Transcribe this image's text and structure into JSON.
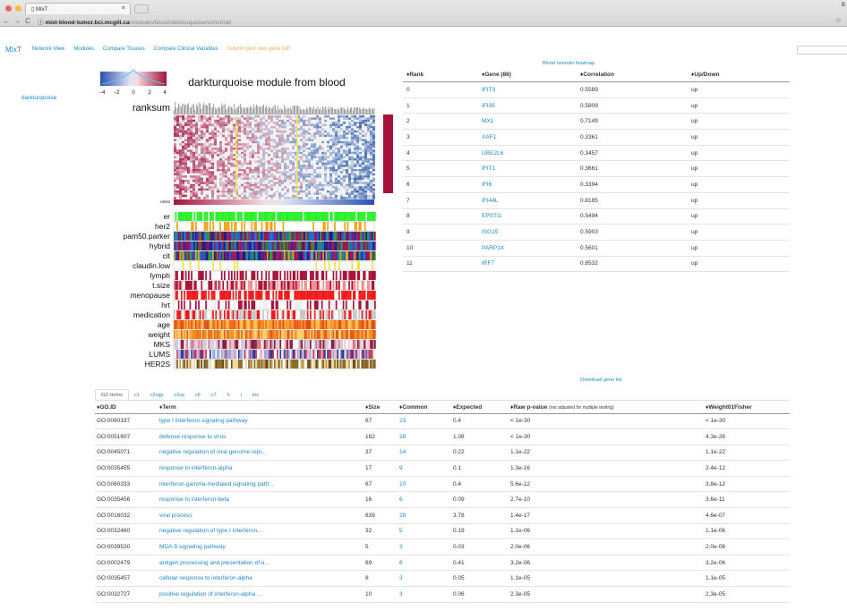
{
  "browser": {
    "tab_title": "MIxT",
    "tab_close": "×",
    "corner_label": "B",
    "url_host": "mixt-blood-tumor.bci.mcgill.ca",
    "url_path": "/modules/blood/darkturquoise/cohort/all",
    "back": "←",
    "forward": "→",
    "reload": "C",
    "info": "ⓘ",
    "star": "☆",
    "dots": [
      "#fc605c",
      "#fdbc40",
      "#34c84a"
    ]
  },
  "nav": {
    "brand": "MIxT",
    "links": [
      "Network View",
      "Modules",
      "Compare Tissues",
      "Compare Clinical Variables"
    ],
    "submit": "Submit your own gene list!",
    "search_text": "C"
  },
  "sidebar": {
    "module_link": "darkturquoise"
  },
  "figure": {
    "title": "darkturquoise module from blood",
    "ranksum_label": "ranksum",
    "ranks_label": "ranks",
    "scale_ticks": [
      "−4",
      "−2",
      "0",
      "2",
      "4"
    ],
    "track_labels": [
      "er",
      "her2",
      "pam50.parker",
      "hybrid",
      "cit",
      "claudin.low",
      "lymph",
      "t.size",
      "menopause",
      "hrt",
      "medication",
      "age",
      "weight",
      "MKS",
      "LUMS",
      "HER2S"
    ],
    "colors": {
      "red": "#a6123b",
      "blue": "#2b5aa8",
      "green": "#2bf12b",
      "orange": "#f0a21a",
      "bright_red": "#f21a1a",
      "yellow": "#f1e24a"
    }
  },
  "gene_table": {
    "heatmap_link": "Blood normals heatmap",
    "headers": [
      "♦Rank",
      "♦Gene (86)",
      "♦Correlation",
      "♦Up/Down"
    ],
    "rows": [
      [
        "0",
        "IFIT3",
        "0.5589",
        "up"
      ],
      [
        "1",
        "IFI35",
        "0.5809",
        "up"
      ],
      [
        "2",
        "MX1",
        "0.7149",
        "up"
      ],
      [
        "3",
        "XAF1",
        "0.3361",
        "up"
      ],
      [
        "4",
        "UBE2L6",
        "0.3457",
        "up"
      ],
      [
        "5",
        "IFIT1",
        "0.3661",
        "up"
      ],
      [
        "6",
        "IFI6",
        "0.3394",
        "up"
      ],
      [
        "7",
        "IFI44L",
        "0.8185",
        "up"
      ],
      [
        "8",
        "EPSTI1",
        "0.5494",
        "up"
      ],
      [
        "9",
        "ISG15",
        "0.5903",
        "up"
      ],
      [
        "10",
        "PARP14",
        "0.5601",
        "up"
      ],
      [
        "11",
        "IRF7",
        "0.8532",
        "up"
      ]
    ]
  },
  "download_label": "Download gene list",
  "go_tabs": [
    "GO terms",
    "c1",
    "c2cgp",
    "c2cp",
    "c6",
    "c7",
    "h",
    "i",
    "iris"
  ],
  "go_table": {
    "headers": [
      "♦GO.ID",
      "♦Term",
      "♦Size",
      "♦Common",
      "♦Expected",
      "♦Raw p-value",
      "♦Weight01Fisher"
    ],
    "pvalue_note": "(not adjusted for multiple testing)",
    "rows": [
      [
        "GO:0060337",
        "type I interferon signaling pathway",
        "67",
        "23",
        "0.4",
        "< 1e-30",
        "< 1e-30"
      ],
      [
        "GO:0051607",
        "defense response to virus",
        "182",
        "28",
        "1.08",
        "< 1e-30",
        "4.3e-26"
      ],
      [
        "GO:0045071",
        "negative regulation of viral genome repl...",
        "37",
        "14",
        "0.22",
        "1.1e-22",
        "1.1e-22"
      ],
      [
        "GO:0035455",
        "response to interferon-alpha",
        "17",
        "9",
        "0.1",
        "1.3e-16",
        "2.4e-12"
      ],
      [
        "GO:0060333",
        "interferon-gamma-mediated signaling path...",
        "67",
        "10",
        "0.4",
        "5.6e-12",
        "3.8e-12"
      ],
      [
        "GO:0035456",
        "response to interferon-beta",
        "16",
        "6",
        "0.09",
        "2.7e-10",
        "3.6e-11"
      ],
      [
        "GO:0016032",
        "viral process",
        "639",
        "28",
        "3.78",
        "1.4e-17",
        "4.6e-07"
      ],
      [
        "GO:0032480",
        "negative regulation of type I interferon...",
        "32",
        "5",
        "0.19",
        "1.1e-06",
        "1.1e-06"
      ],
      [
        "GO:0039530",
        "MDA-5 signaling pathway",
        "5",
        "3",
        "0.03",
        "2.0e-06",
        "2.0e-06"
      ],
      [
        "GO:0002479",
        "antigen processing and presentation of e...",
        "69",
        "6",
        "0.41",
        "3.2e-06",
        "3.2e-06"
      ],
      [
        "GO:0035457",
        "cellular response to interferon-alpha",
        "8",
        "3",
        "0.05",
        "1.1e-05",
        "1.1e-05"
      ],
      [
        "GO:0032727",
        "positive regulation of interferon-alpha ...",
        "10",
        "3",
        "0.06",
        "2.3e-05",
        "2.3e-05"
      ]
    ]
  }
}
